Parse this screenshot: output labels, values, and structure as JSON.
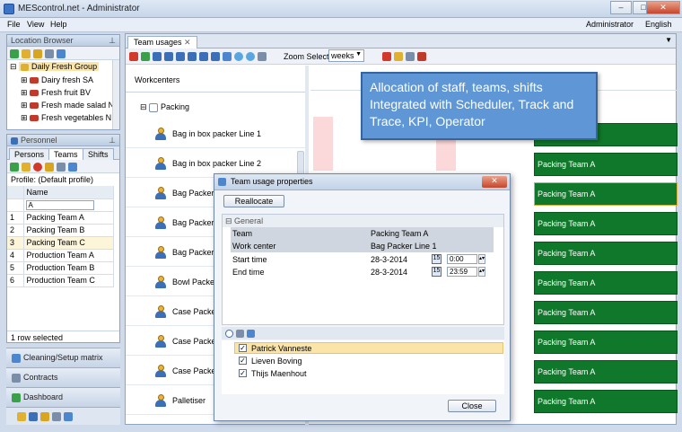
{
  "window": {
    "title": "MEScontrol.net - Administrator"
  },
  "menu": {
    "items": [
      "File",
      "View",
      "Help"
    ],
    "user": "Administrator",
    "language": "English"
  },
  "location_browser": {
    "title": "Location Browser",
    "root": "Daily Fresh Group",
    "items": [
      "Dairy fresh SA",
      "Fresh fruit BV",
      "Fresh made salad N",
      "Fresh vegetables N"
    ]
  },
  "personnel": {
    "title": "Personnel",
    "tabs": [
      "Persons",
      "Teams",
      "Shifts"
    ],
    "profile": "Profile: (Default profile)",
    "column": "Name",
    "rows": [
      {
        "n": "1",
        "name": "Packing Team A"
      },
      {
        "n": "2",
        "name": "Packing Team B"
      },
      {
        "n": "3",
        "name": "Packing Team C"
      },
      {
        "n": "4",
        "name": "Production Team A"
      },
      {
        "n": "5",
        "name": "Production Team B"
      },
      {
        "n": "6",
        "name": "Production Team C"
      }
    ],
    "status": "1 row selected"
  },
  "nav": {
    "items": [
      "Cleaning/Setup matrix",
      "Contracts",
      "Dashboard"
    ]
  },
  "doc_tab": {
    "label": "Team usages"
  },
  "toolbar": {
    "zoom_label": "Zoom Select",
    "zoom_value": "weeks"
  },
  "workcenters": {
    "header": "Workcenters",
    "group": "Packing",
    "items": [
      "Bag in box packer Line 1",
      "Bag in box packer Line 2",
      "Bag Packer Li",
      "Bag Packer Li",
      "Bag Packer Li",
      "Bowl Packer",
      "Case Packer",
      "Case Packer 2",
      "Case Packer 3",
      "Palletiser"
    ]
  },
  "callout": {
    "text": "Allocation of staff, teams, shifts Integrated with Scheduler, Track and Trace, KPI, Operator"
  },
  "gantt": {
    "bars": [
      "",
      "Packing Team A",
      "Packing Team A",
      "Packing Team A",
      "Packing Team A",
      "Packing Team A",
      "Packing Team A",
      "Packing Team A",
      "Packing Team A",
      "Packing Team A"
    ]
  },
  "dialog": {
    "title": "Team usage properties",
    "reallocate": "Reallocate",
    "section": "General",
    "team_label": "Team",
    "team_value": "Packing Team A",
    "wc_label": "Work center",
    "wc_value": "Bag Packer Line 1",
    "start_label": "Start time",
    "start_date": "28-3-2014",
    "start_time": "0:00",
    "end_label": "End time",
    "end_date": "28-3-2014",
    "end_time": "23:59",
    "members": [
      "Patrick Vanneste",
      "Lieven Boving",
      "Thijs Maenhout"
    ],
    "close": "Close"
  },
  "colors": {
    "gantt_green": "#10782a",
    "selection": "#fbe4a8",
    "callout": "#5f97d6"
  }
}
